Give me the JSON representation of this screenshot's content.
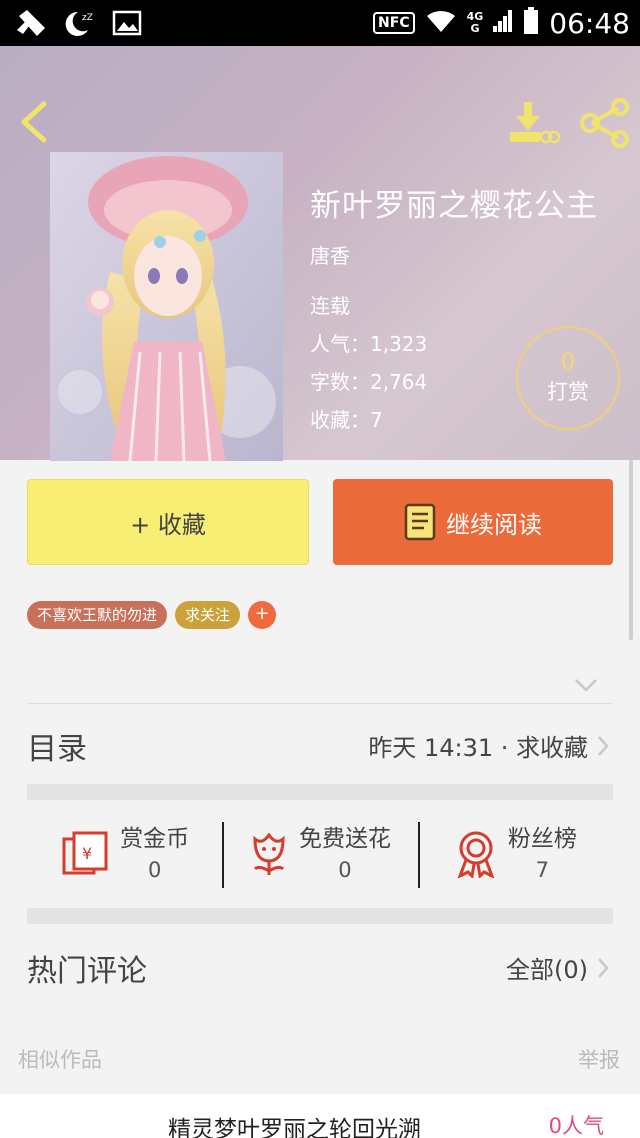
{
  "status_bar": {
    "nfc": "NFC",
    "network_top": "4G",
    "network_bottom": "G",
    "time": "06:48"
  },
  "book": {
    "title": "新叶罗丽之樱花公主",
    "author": "唐香",
    "status": "连载",
    "popularity": "人气：1,323",
    "word_count": "字数：2,764",
    "favorites": "收藏：7"
  },
  "tip": {
    "count": "0",
    "label": "打赏"
  },
  "actions": {
    "favorite": "+ 收藏",
    "read": "继续阅读"
  },
  "tags": [
    "不喜欢王默的勿进",
    "求关注",
    "+"
  ],
  "toc": {
    "title": "目录",
    "updated": "昨天 14:31 · 求收藏"
  },
  "stats": [
    {
      "label": "赏金币",
      "value": "0",
      "icon": "red-envelope-icon"
    },
    {
      "label": "免费送花",
      "value": "0",
      "icon": "flower-icon"
    },
    {
      "label": "粉丝榜",
      "value": "7",
      "icon": "medal-icon"
    }
  ],
  "comments": {
    "title": "热门评论",
    "all": "全部(0)"
  },
  "similar": {
    "label": "相似作品",
    "report": "举报",
    "item_title": "精灵梦叶罗丽之轮回光溯",
    "item_popularity": "0人气"
  },
  "colors": {
    "accent_orange": "#ea6a3a",
    "favorite_yellow": "#f8ee74",
    "tip_gold": "#f1d07a",
    "popularity_pink": "#e04b84"
  }
}
